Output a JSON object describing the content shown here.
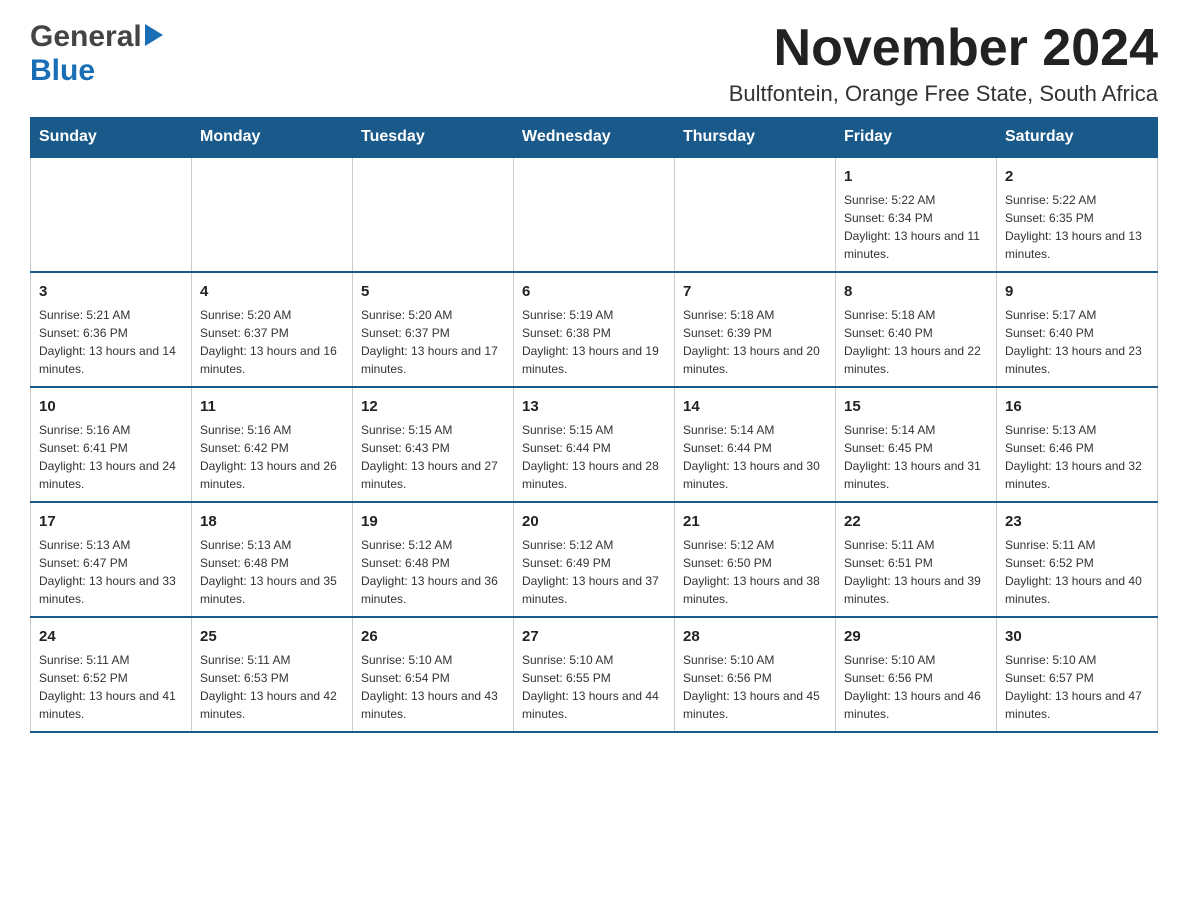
{
  "header": {
    "logo": {
      "general": "General",
      "blue": "Blue"
    },
    "title": "November 2024",
    "subtitle": "Bultfontein, Orange Free State, South Africa"
  },
  "weekdays": [
    "Sunday",
    "Monday",
    "Tuesday",
    "Wednesday",
    "Thursday",
    "Friday",
    "Saturday"
  ],
  "weeks": [
    [
      {
        "day": "",
        "sunrise": "",
        "sunset": "",
        "daylight": ""
      },
      {
        "day": "",
        "sunrise": "",
        "sunset": "",
        "daylight": ""
      },
      {
        "day": "",
        "sunrise": "",
        "sunset": "",
        "daylight": ""
      },
      {
        "day": "",
        "sunrise": "",
        "sunset": "",
        "daylight": ""
      },
      {
        "day": "",
        "sunrise": "",
        "sunset": "",
        "daylight": ""
      },
      {
        "day": "1",
        "sunrise": "Sunrise: 5:22 AM",
        "sunset": "Sunset: 6:34 PM",
        "daylight": "Daylight: 13 hours and 11 minutes."
      },
      {
        "day": "2",
        "sunrise": "Sunrise: 5:22 AM",
        "sunset": "Sunset: 6:35 PM",
        "daylight": "Daylight: 13 hours and 13 minutes."
      }
    ],
    [
      {
        "day": "3",
        "sunrise": "Sunrise: 5:21 AM",
        "sunset": "Sunset: 6:36 PM",
        "daylight": "Daylight: 13 hours and 14 minutes."
      },
      {
        "day": "4",
        "sunrise": "Sunrise: 5:20 AM",
        "sunset": "Sunset: 6:37 PM",
        "daylight": "Daylight: 13 hours and 16 minutes."
      },
      {
        "day": "5",
        "sunrise": "Sunrise: 5:20 AM",
        "sunset": "Sunset: 6:37 PM",
        "daylight": "Daylight: 13 hours and 17 minutes."
      },
      {
        "day": "6",
        "sunrise": "Sunrise: 5:19 AM",
        "sunset": "Sunset: 6:38 PM",
        "daylight": "Daylight: 13 hours and 19 minutes."
      },
      {
        "day": "7",
        "sunrise": "Sunrise: 5:18 AM",
        "sunset": "Sunset: 6:39 PM",
        "daylight": "Daylight: 13 hours and 20 minutes."
      },
      {
        "day": "8",
        "sunrise": "Sunrise: 5:18 AM",
        "sunset": "Sunset: 6:40 PM",
        "daylight": "Daylight: 13 hours and 22 minutes."
      },
      {
        "day": "9",
        "sunrise": "Sunrise: 5:17 AM",
        "sunset": "Sunset: 6:40 PM",
        "daylight": "Daylight: 13 hours and 23 minutes."
      }
    ],
    [
      {
        "day": "10",
        "sunrise": "Sunrise: 5:16 AM",
        "sunset": "Sunset: 6:41 PM",
        "daylight": "Daylight: 13 hours and 24 minutes."
      },
      {
        "day": "11",
        "sunrise": "Sunrise: 5:16 AM",
        "sunset": "Sunset: 6:42 PM",
        "daylight": "Daylight: 13 hours and 26 minutes."
      },
      {
        "day": "12",
        "sunrise": "Sunrise: 5:15 AM",
        "sunset": "Sunset: 6:43 PM",
        "daylight": "Daylight: 13 hours and 27 minutes."
      },
      {
        "day": "13",
        "sunrise": "Sunrise: 5:15 AM",
        "sunset": "Sunset: 6:44 PM",
        "daylight": "Daylight: 13 hours and 28 minutes."
      },
      {
        "day": "14",
        "sunrise": "Sunrise: 5:14 AM",
        "sunset": "Sunset: 6:44 PM",
        "daylight": "Daylight: 13 hours and 30 minutes."
      },
      {
        "day": "15",
        "sunrise": "Sunrise: 5:14 AM",
        "sunset": "Sunset: 6:45 PM",
        "daylight": "Daylight: 13 hours and 31 minutes."
      },
      {
        "day": "16",
        "sunrise": "Sunrise: 5:13 AM",
        "sunset": "Sunset: 6:46 PM",
        "daylight": "Daylight: 13 hours and 32 minutes."
      }
    ],
    [
      {
        "day": "17",
        "sunrise": "Sunrise: 5:13 AM",
        "sunset": "Sunset: 6:47 PM",
        "daylight": "Daylight: 13 hours and 33 minutes."
      },
      {
        "day": "18",
        "sunrise": "Sunrise: 5:13 AM",
        "sunset": "Sunset: 6:48 PM",
        "daylight": "Daylight: 13 hours and 35 minutes."
      },
      {
        "day": "19",
        "sunrise": "Sunrise: 5:12 AM",
        "sunset": "Sunset: 6:48 PM",
        "daylight": "Daylight: 13 hours and 36 minutes."
      },
      {
        "day": "20",
        "sunrise": "Sunrise: 5:12 AM",
        "sunset": "Sunset: 6:49 PM",
        "daylight": "Daylight: 13 hours and 37 minutes."
      },
      {
        "day": "21",
        "sunrise": "Sunrise: 5:12 AM",
        "sunset": "Sunset: 6:50 PM",
        "daylight": "Daylight: 13 hours and 38 minutes."
      },
      {
        "day": "22",
        "sunrise": "Sunrise: 5:11 AM",
        "sunset": "Sunset: 6:51 PM",
        "daylight": "Daylight: 13 hours and 39 minutes."
      },
      {
        "day": "23",
        "sunrise": "Sunrise: 5:11 AM",
        "sunset": "Sunset: 6:52 PM",
        "daylight": "Daylight: 13 hours and 40 minutes."
      }
    ],
    [
      {
        "day": "24",
        "sunrise": "Sunrise: 5:11 AM",
        "sunset": "Sunset: 6:52 PM",
        "daylight": "Daylight: 13 hours and 41 minutes."
      },
      {
        "day": "25",
        "sunrise": "Sunrise: 5:11 AM",
        "sunset": "Sunset: 6:53 PM",
        "daylight": "Daylight: 13 hours and 42 minutes."
      },
      {
        "day": "26",
        "sunrise": "Sunrise: 5:10 AM",
        "sunset": "Sunset: 6:54 PM",
        "daylight": "Daylight: 13 hours and 43 minutes."
      },
      {
        "day": "27",
        "sunrise": "Sunrise: 5:10 AM",
        "sunset": "Sunset: 6:55 PM",
        "daylight": "Daylight: 13 hours and 44 minutes."
      },
      {
        "day": "28",
        "sunrise": "Sunrise: 5:10 AM",
        "sunset": "Sunset: 6:56 PM",
        "daylight": "Daylight: 13 hours and 45 minutes."
      },
      {
        "day": "29",
        "sunrise": "Sunrise: 5:10 AM",
        "sunset": "Sunset: 6:56 PM",
        "daylight": "Daylight: 13 hours and 46 minutes."
      },
      {
        "day": "30",
        "sunrise": "Sunrise: 5:10 AM",
        "sunset": "Sunset: 6:57 PM",
        "daylight": "Daylight: 13 hours and 47 minutes."
      }
    ]
  ]
}
